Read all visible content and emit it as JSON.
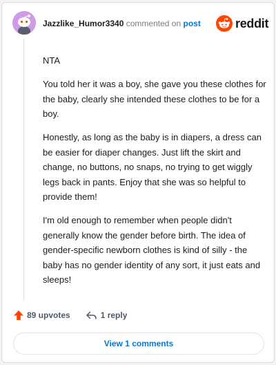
{
  "header": {
    "username": "Jazzlike_Humor3340",
    "commented_on": "commented on",
    "post_link": "post",
    "logo_text": "reddit"
  },
  "comment": {
    "paragraphs": [
      "NTA",
      "You told her it was a boy, she gave you these clothes for the baby, clearly she intended these clothes to be for a boy.",
      "Honestly, as long as the baby is in diapers, a dress can be easier for diaper changes. Just lift the skirt and change, no buttons, no snaps, no trying to get wiggly legs back in pants. Enjoy that she was so helpful to provide them!",
      "I'm old enough to remember when people didn't generally know the gender before birth. The idea of gender-specific newborn clothes is kind of silly - the baby has no gender identity of any sort, it just eats and sleeps!"
    ]
  },
  "actions": {
    "upvotes_label": "89 upvotes",
    "reply_label": "1 reply"
  },
  "footer": {
    "view_comments_label": "View 1 comments"
  },
  "colors": {
    "accent_blue": "#0079d3",
    "reddit_orange": "#ff4500",
    "avatar_bg": "#cf9be4"
  },
  "icons": {
    "avatar": "snoo-avatar-icon",
    "logo": "reddit-snoo-icon",
    "upvote": "upvote-arrow-icon",
    "reply": "reply-arrow-icon"
  }
}
